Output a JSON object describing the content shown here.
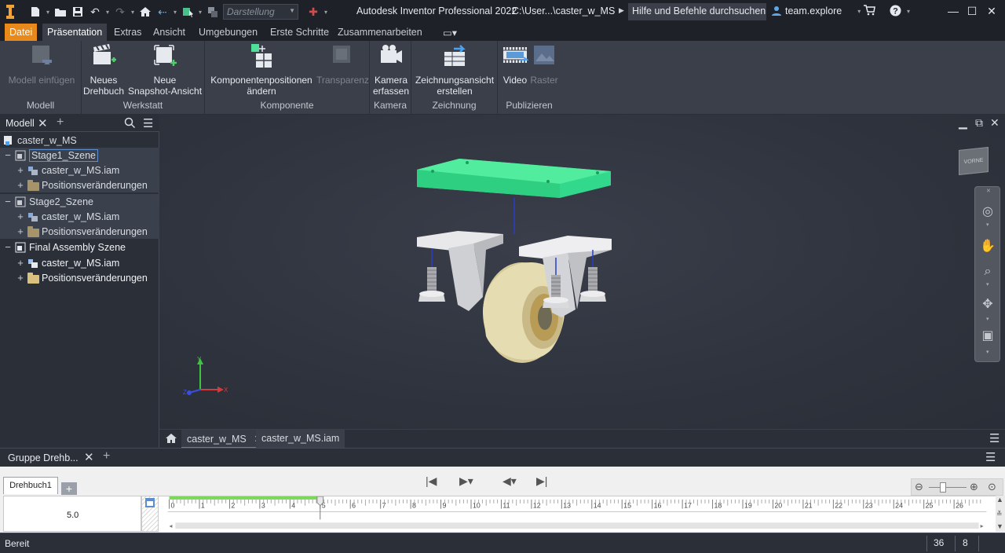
{
  "titlebar": {
    "app_title": "Autodesk Inventor Professional 2022",
    "doc_path": "C:\\User...\\caster_w_MS",
    "search_placeholder": "Hilfe und Befehle durchsuchen..",
    "user_name": "team.explore",
    "appearance_combo": "Darstellung"
  },
  "ribbon": {
    "tabs": [
      {
        "label": "Datei",
        "state": "file"
      },
      {
        "label": "Präsentation",
        "state": "active"
      },
      {
        "label": "Extras",
        "state": ""
      },
      {
        "label": "Ansicht",
        "state": ""
      },
      {
        "label": "Umgebungen",
        "state": ""
      },
      {
        "label": "Erste Schritte",
        "state": ""
      },
      {
        "label": "Zusammenarbeiten",
        "state": ""
      }
    ],
    "groups": {
      "modell": {
        "label": "Modell",
        "insert_model": "Modell einfügen"
      },
      "werkstatt": {
        "label": "Werkstatt",
        "new_storyboard_line1": "Neues",
        "new_storyboard_line2": "Drehbuch",
        "new_snapshot_line1": "Neue",
        "new_snapshot_line2": "Snapshot-Ansicht"
      },
      "komponente": {
        "label": "Komponente",
        "tweak_line1": "Komponentenpositionen",
        "tweak_line2": "ändern",
        "opacity": "Transparenz"
      },
      "kamera": {
        "label": "Kamera",
        "capture_line1": "Kamera",
        "capture_line2": "erfassen"
      },
      "zeichnung": {
        "label": "Zeichnung",
        "drawing_line1": "Zeichnungsansicht",
        "drawing_line2": "erstellen"
      },
      "publizieren": {
        "label": "Publizieren",
        "video": "Video",
        "raster": "Raster"
      }
    }
  },
  "browser": {
    "tab_label": "Modell",
    "root": "caster_w_MS",
    "stage1": "Stage1_Szene",
    "stage1_assembly": "caster_w_MS.iam",
    "stage1_tweaks": "Positionsveränderungen",
    "stage2": "Stage2_Szene",
    "stage2_assembly": "caster_w_MS.iam",
    "stage2_tweaks": "Positionsveränderungen",
    "final": "Final Assembly Szene",
    "final_assembly": "caster_w_MS.iam",
    "final_tweaks": "Positionsveränderungen"
  },
  "viewport": {
    "viewcube_label": "VORNE",
    "axis_x": "X",
    "axis_y": "Y",
    "axis_z": "Z"
  },
  "doctabs": {
    "tab1": "caster_w_MS",
    "tab2": "caster_w_MS.iam"
  },
  "storyboard": {
    "panel_title": "Gruppe Drehb...",
    "tab_label": "Drehbuch1",
    "duration_value": "5.0",
    "tick_labels": [
      "0",
      "1",
      "2",
      "3",
      "4",
      "5",
      "6",
      "7",
      "8",
      "9",
      "10",
      "11",
      "12",
      "13",
      "14",
      "15",
      "16",
      "17",
      "18",
      "19",
      "20",
      "21",
      "22",
      "23",
      "24",
      "25",
      "26"
    ],
    "playhead_seconds": 5.0,
    "animated_range_seconds": [
      0,
      5
    ]
  },
  "status": {
    "text": "Bereit",
    "count1": "36",
    "count2": "8"
  },
  "colors": {
    "file_tab": "#e8891b",
    "active_doc_tab": "#2d8ce8",
    "top_plate": "#3ee596",
    "timeline_bar": "#7bd85a"
  }
}
